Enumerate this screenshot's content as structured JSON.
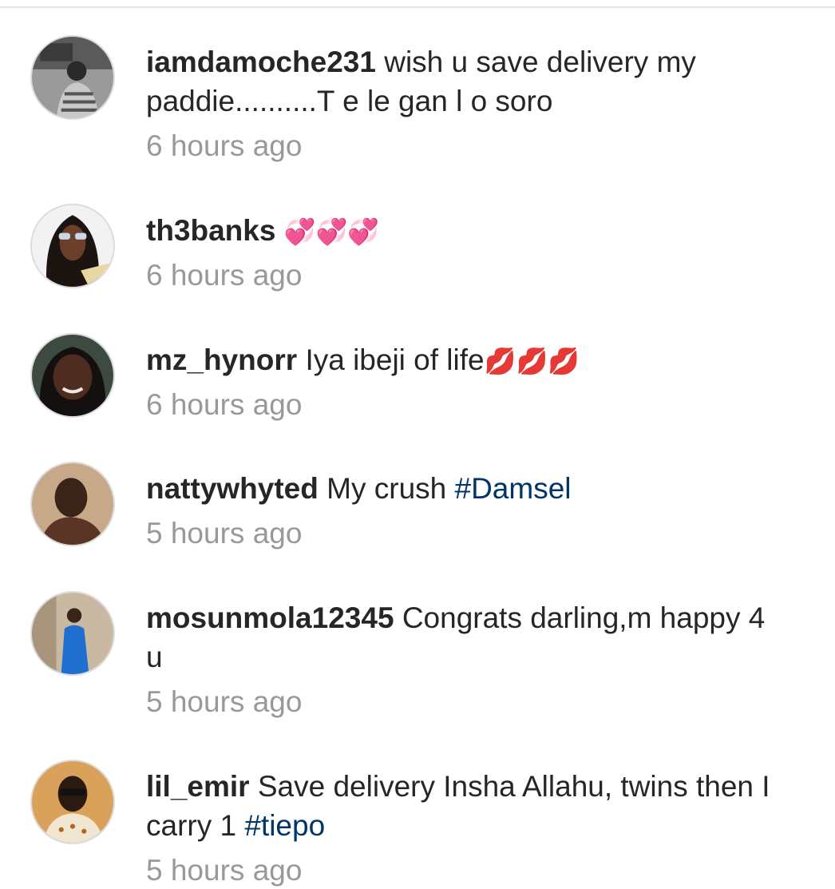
{
  "comments": [
    {
      "username": "iamdamoche231",
      "text": "wish u save delivery my paddie..........T e le gan l o soro",
      "time": "6 hours ago",
      "avatar_icon": "profile-photo"
    },
    {
      "username": "th3banks",
      "text": "",
      "emoji": "💞💞💞",
      "time": "6 hours ago",
      "avatar_icon": "profile-photo"
    },
    {
      "username": "mz_hynorr",
      "text": "Iya ibeji of life",
      "emoji": "💋💋💋",
      "time": "6 hours ago",
      "avatar_icon": "profile-photo"
    },
    {
      "username": "nattywhyted",
      "text": "My crush",
      "hashtag": "#Damsel",
      "time": "5 hours ago",
      "avatar_icon": "profile-photo"
    },
    {
      "username": "mosunmola12345",
      "text": "Congrats darling,m happy 4 u",
      "time": "5 hours ago",
      "avatar_icon": "profile-photo"
    },
    {
      "username": "lil_emir",
      "text": "Save delivery Insha Allahu, twins then I carry 1",
      "hashtag": "#tiepo",
      "time": "5 hours ago",
      "avatar_icon": "profile-photo"
    }
  ],
  "colors": {
    "username": "#262626",
    "text": "#262626",
    "time": "#999999",
    "hashtag": "#003569"
  }
}
